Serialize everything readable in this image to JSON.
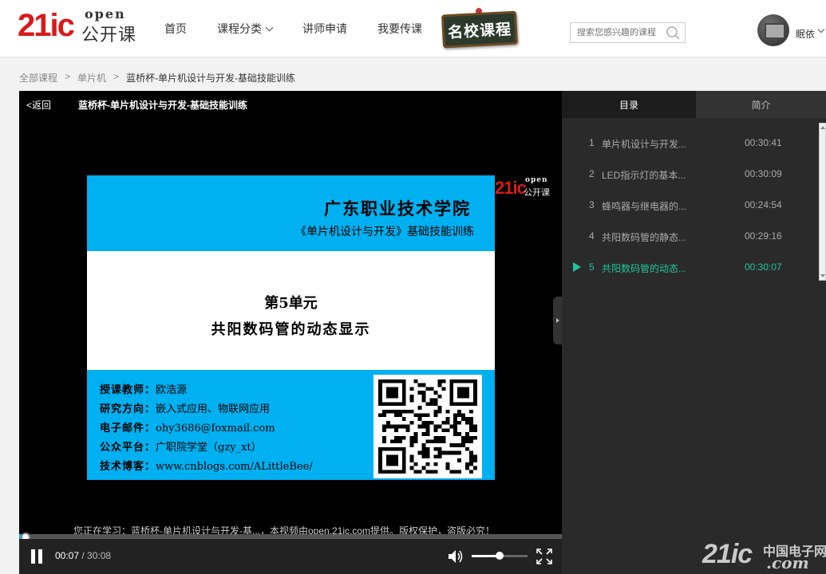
{
  "header": {
    "logo_main": "21ic",
    "logo_open": "open",
    "logo_sub": "公开课",
    "nav": [
      {
        "label": "首页"
      },
      {
        "label": "课程分类"
      },
      {
        "label": "讲师申请"
      },
      {
        "label": "我要传课"
      }
    ],
    "badge": "名校课程",
    "search_placeholder": "搜索您感兴趣的课程",
    "username": "眠依"
  },
  "breadcrumb": {
    "items": [
      "全部课程",
      "单片机",
      "蓝桥杯-单片机设计与开发-基础技能训练"
    ],
    "sep": ">"
  },
  "player": {
    "back": "<返回",
    "title": "蓝桥杯-单片机设计与开发-基础技能训练",
    "notice": "您正在学习：蓝桥杯-单片机设计与开发-基...，本视频由open.21ic.com提供。版权保护，盗版必究！",
    "current_time": "00:07",
    "duration": "30:08",
    "progress_fraction": 0.0039,
    "volume_fraction": 0.5,
    "video_logo": {
      "main": "21ic",
      "open": "open",
      "sub": "公开课"
    },
    "slide": {
      "school": "广东职业技术学院",
      "course": "《单片机设计与开发》基础技能训练",
      "unit": "第5单元",
      "topic": "共阳数码管的动态显示",
      "info": [
        {
          "key": "授课教师：",
          "value": "欧浩源"
        },
        {
          "key": "研究方向：",
          "value": "嵌入式应用、物联网应用"
        },
        {
          "key": "电子邮件：",
          "value": "ohy3686@foxmail.com"
        },
        {
          "key": "公众平台：",
          "value": "广职院学堂（gzy_xt）"
        },
        {
          "key": "技术博客：",
          "value": "www.cnblogs.com/ALittleBee/"
        }
      ]
    }
  },
  "sidebar": {
    "tabs": [
      {
        "label": "目录",
        "active": true
      },
      {
        "label": "简介",
        "active": false
      }
    ],
    "lessons": [
      {
        "num": "1",
        "name": "单片机设计与开发...",
        "duration": "00:30:41",
        "active": false
      },
      {
        "num": "2",
        "name": "LED指示灯的基本...",
        "duration": "00:30:09",
        "active": false
      },
      {
        "num": "3",
        "name": "蜂鸣器与继电器的...",
        "duration": "00:24:54",
        "active": false
      },
      {
        "num": "4",
        "name": "共阳数码管的静态...",
        "duration": "00:29:16",
        "active": false
      },
      {
        "num": "5",
        "name": "共阳数码管的动态...",
        "duration": "00:30:07",
        "active": true
      }
    ]
  },
  "watermark": {
    "w1": "21ic",
    "w2": "中国电子网",
    "w3": ".com"
  },
  "colors": {
    "accent_green": "#1fc59a",
    "brand_red": "#d91a1a",
    "slide_blue": "#00b0f0"
  }
}
